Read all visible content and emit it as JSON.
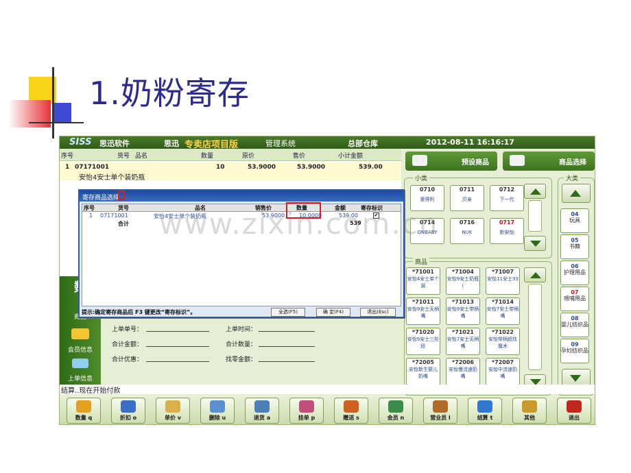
{
  "slide": {
    "title": "1.奶粉寄存"
  },
  "app": {
    "logo": "SISS",
    "brand": "思迅软件",
    "brand2": "思迅",
    "edition": "专卖店项目版",
    "system": "管理系统",
    "store": "总部仓库",
    "datetime": "2012-08-11 16:16:17"
  },
  "sales": {
    "headers": [
      "序号",
      "货号",
      "品名",
      "数量",
      "原价",
      "售价",
      "小计金额"
    ],
    "row": {
      "seq": "1",
      "code": "07171001",
      "qty": "10",
      "orig": "53.9000",
      "price": "53.9000",
      "subtotal": "539.00",
      "name": "安怡4安士单个装奶瓶"
    }
  },
  "right": {
    "btn_preset": "预设商品",
    "btn_select": "商品选择",
    "small_label": "小类",
    "big_label": "大类",
    "goods_label": "商品",
    "small_items": [
      {
        "code": "0710",
        "name": "爱得利",
        "red": false
      },
      {
        "code": "0711",
        "name": "贝亲",
        "red": false
      },
      {
        "code": "0712",
        "name": "下一代",
        "red": false
      },
      {
        "code": "0714",
        "name": "ONBABY",
        "red": false
      },
      {
        "code": "0716",
        "name": "NUK",
        "red": false
      },
      {
        "code": "0717",
        "name": "新安怡",
        "red": true
      }
    ],
    "goods_items": [
      {
        "code": "*71001",
        "name": "安怡4安士单个装"
      },
      {
        "code": "*71004",
        "name": "安怡9安士奶瓶("
      },
      {
        "code": "*71007",
        "name": "安怡11安士33"
      },
      {
        "code": "*71011",
        "name": "安怡9安士无柄嘴"
      },
      {
        "code": "*71013",
        "name": "安怡9安士带柄嘴"
      },
      {
        "code": "*71014",
        "name": "安怡7安士带柄嘴"
      },
      {
        "code": "*71020",
        "name": "安怡9安士三阶段"
      },
      {
        "code": "*71021",
        "name": "安怡7安士无柄嘴"
      },
      {
        "code": "*71022",
        "name": "安怡带柄超炫魔术"
      },
      {
        "code": "*72005",
        "name": "安怡新生婴儿奶嘴"
      },
      {
        "code": "*72006",
        "name": "安怡慢流速奶嘴"
      },
      {
        "code": "*72007",
        "name": "安怡中流速奶嘴"
      }
    ],
    "big_items": [
      {
        "code": "04",
        "name": "玩具",
        "red": false
      },
      {
        "code": "05",
        "name": "书籍",
        "red": false
      },
      {
        "code": "06",
        "name": "护理用品",
        "red": false
      },
      {
        "code": "07",
        "name": "喂哺用品",
        "red": true
      },
      {
        "code": "08",
        "name": "婴儿纺织品",
        "red": false
      },
      {
        "code": "09",
        "name": "孕妇纺织品",
        "red": false
      }
    ]
  },
  "nav": {
    "big_char": "数",
    "goods": "商品",
    "member": "会员信息",
    "upload": "上单信息"
  },
  "form": {
    "prev_no": "上单单号：",
    "prev_time": "上单时间：",
    "total_amount": "合计金额：",
    "total_qty": "合计数量：",
    "total_discount": "合计优惠：",
    "change": "找零金额："
  },
  "status": "结算..现在开始付款",
  "toolbar": [
    {
      "label": "数量 q",
      "color": "#e0a020"
    },
    {
      "label": "折扣 o",
      "color": "#3b6fc6"
    },
    {
      "label": "单价 v",
      "color": "#d9b04a"
    },
    {
      "label": "删除 u",
      "color": "#5a8fd0"
    },
    {
      "label": "退货 a",
      "color": "#4c7fb8"
    },
    {
      "label": "挂单 p",
      "color": "#c24f7a"
    },
    {
      "label": "赠送 s",
      "color": "#d06020"
    },
    {
      "label": "会员 n",
      "color": "#3c8c4a"
    },
    {
      "label": "营业员 l",
      "color": "#b06a2a"
    },
    {
      "label": "结算 t",
      "color": "#2f7ad0"
    },
    {
      "label": "其他",
      "color": "#c89a2a"
    },
    {
      "label": "退出",
      "color": "#c0281e"
    }
  ],
  "dialog": {
    "title": "寄存商品选择",
    "headers": [
      "序号",
      "货号",
      "品名",
      "销售价",
      "数量",
      "金额",
      "寄存标识"
    ],
    "row": {
      "seq": "1",
      "code": "07171001",
      "name": "安怡4安士单个装奶瓶",
      "price": "53.9000",
      "qty": "10.0000",
      "amount": "539.00"
    },
    "total_label": "合计",
    "total_amount": "539",
    "hint": "提示:确定寄存商品后 F3 键更改“寄存标识”。",
    "btn_all": "全选(F5)",
    "btn_ok": "确 定(F4)",
    "btn_exit": "退出(Esc)"
  },
  "watermark": "www.zixin.com.cn"
}
